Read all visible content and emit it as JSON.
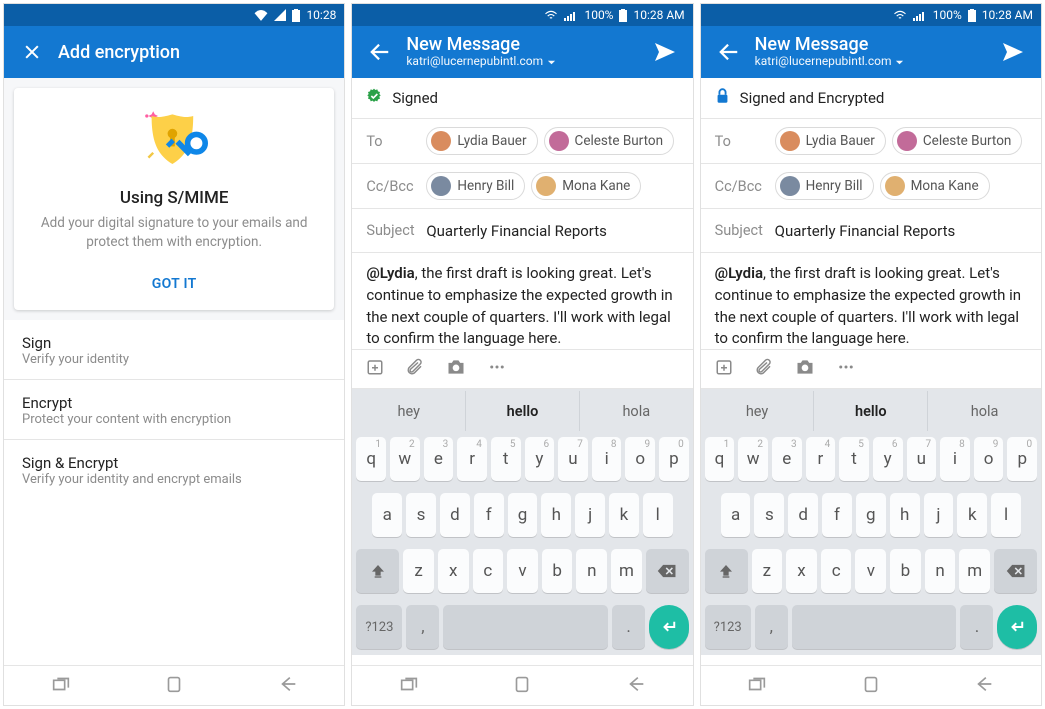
{
  "screen1": {
    "status": {
      "time": "10:28"
    },
    "appbar": {
      "title": "Add encryption"
    },
    "card": {
      "title": "Using S/MIME",
      "desc": "Add your digital signature to your emails and protect them with encryption.",
      "cta": "GOT IT"
    },
    "options": [
      {
        "title": "Sign",
        "sub": "Verify your identity"
      },
      {
        "title": "Encrypt",
        "sub": "Protect your content with encryption"
      },
      {
        "title": "Sign & Encrypt",
        "sub": "Verify your identity and encrypt emails"
      }
    ]
  },
  "compose": {
    "status": {
      "pct": "100%",
      "time": "10:28 AM"
    },
    "appbar": {
      "title": "New Message",
      "from": "katri@lucernepubintl.com"
    },
    "to_label": "To",
    "cc_label": "Cc/Bcc",
    "subject_label": "Subject",
    "subject": "Quarterly Financial Reports",
    "recipients_to": [
      "Lydia Bauer",
      "Celeste Burton"
    ],
    "recipients_cc": [
      "Henry Bill",
      "Mona Kane"
    ],
    "body_mention": "@Lydia",
    "body_rest": ", the first draft is looking great. Let's continue to emphasize the expected growth in the next couple of quarters. I'll work with legal to confirm the language here."
  },
  "screen2": {
    "banner": "Signed"
  },
  "screen3": {
    "banner": "Signed and Encrypted"
  },
  "keyboard": {
    "suggestions": [
      "hey",
      "hello",
      "hola"
    ],
    "row1": [
      "q",
      "w",
      "e",
      "r",
      "t",
      "y",
      "u",
      "i",
      "o",
      "p"
    ],
    "row1_hints": [
      "1",
      "2",
      "3",
      "4",
      "5",
      "6",
      "7",
      "8",
      "9",
      "0"
    ],
    "row2": [
      "a",
      "s",
      "d",
      "f",
      "g",
      "h",
      "j",
      "k",
      "l"
    ],
    "row3": [
      "z",
      "x",
      "c",
      "v",
      "b",
      "n",
      "m"
    ],
    "sym": "?123",
    "comma": ",",
    "period": "."
  }
}
